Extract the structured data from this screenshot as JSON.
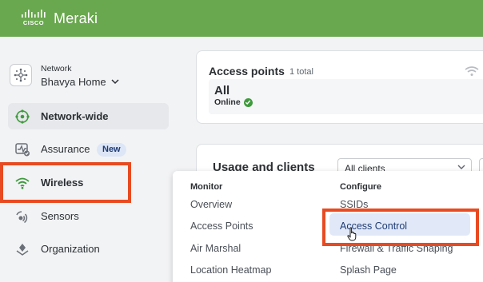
{
  "header": {
    "brand_small": "CISCO",
    "brand": "Meraki"
  },
  "network": {
    "label": "Network",
    "name": "Bhavya Home"
  },
  "nav": [
    {
      "label": "Network-wide",
      "icon": "network-wide-icon"
    },
    {
      "label": "Assurance",
      "icon": "assurance-icon",
      "badge": "New"
    },
    {
      "label": "Wireless",
      "icon": "wifi-icon"
    },
    {
      "label": "Sensors",
      "icon": "sensor-icon"
    },
    {
      "label": "Organization",
      "icon": "organization-icon"
    }
  ],
  "access_points_card": {
    "title": "Access points",
    "total": "1 total",
    "filter": "All",
    "status": "Online"
  },
  "usage_card": {
    "title": "Usage and clients",
    "select_value": "All clients"
  },
  "dropdown": {
    "monitor": {
      "heading": "Monitor",
      "items": [
        "Overview",
        "Access Points",
        "Air Marshal",
        "Location Heatmap"
      ]
    },
    "configure": {
      "heading": "Configure",
      "items": [
        "SSIDs",
        "Access Control",
        "Firewall & Traffic Shaping",
        "Splash Page"
      ]
    }
  },
  "colors": {
    "header": "#6aa84f",
    "highlight": "#e84a21",
    "accent": "#1f3b73"
  }
}
